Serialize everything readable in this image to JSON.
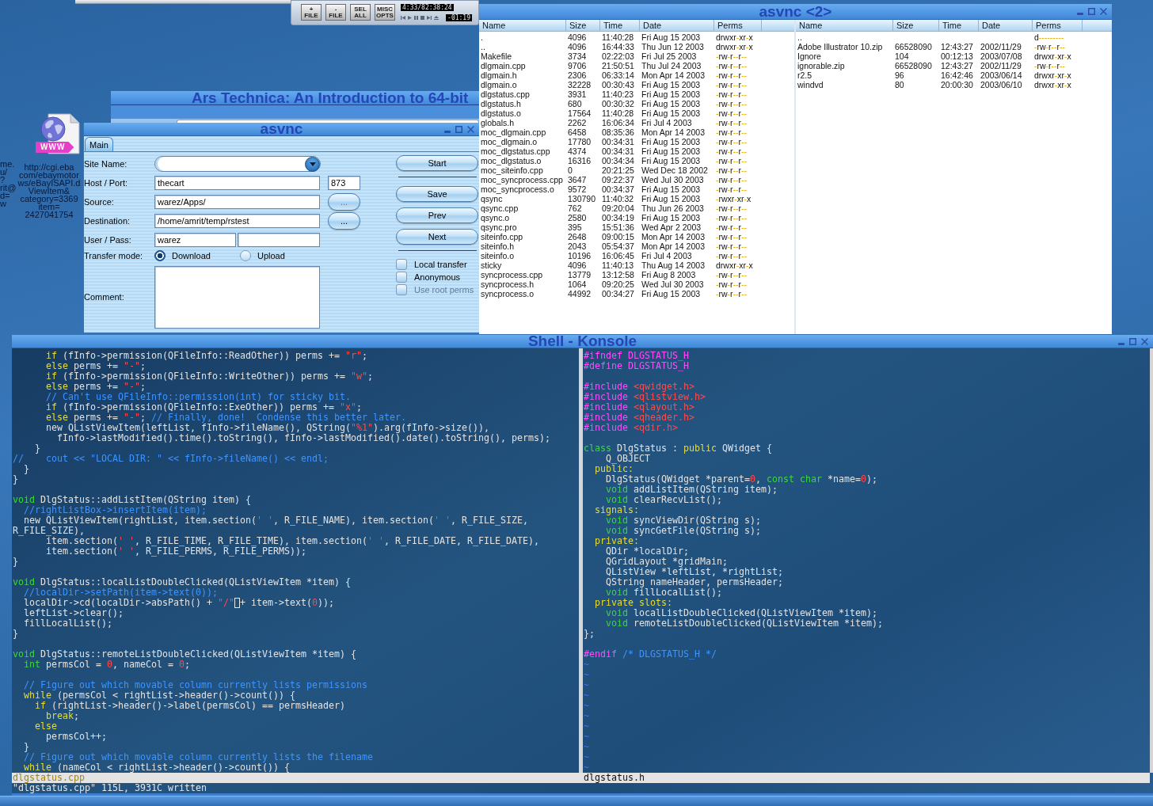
{
  "player": {
    "buttons": [
      "+ FILE",
      "- FILE",
      "SEL ALL",
      "MISC OPTS"
    ],
    "time_display": "4:33/82:38:24",
    "remaining_time": "-01:19"
  },
  "browser_window": {
    "title": "Ars Technica: An Introduction to 64-bit"
  },
  "desktop_icon": {
    "tag": "WWW",
    "label_lines": [
      "http://cgi.eba",
      "com/ebaymotor",
      "ws/eBayISAPI.d",
      "ViewItem&",
      "category=3369",
      "item=",
      "2427041754"
    ]
  },
  "edge_icon_label_lines": [
    "me.",
    "u/",
    "?",
    "rit@",
    "d=",
    "w"
  ],
  "dialog": {
    "title": "asvnc",
    "tabs": [
      {
        "label": "Main",
        "selected": true
      }
    ],
    "site_name": {
      "label": "Site Name:"
    },
    "host": {
      "label": "Host / Port:",
      "value": "thecart",
      "port": "873"
    },
    "source": {
      "label": "Source:",
      "value": "warez/Apps/",
      "browse": {
        "label": "...",
        "disabled": true
      }
    },
    "destination": {
      "label": "Destination:",
      "value": "/home/amrit/temp/rstest",
      "browse": {
        "label": "...",
        "disabled": false
      }
    },
    "user": {
      "label": "User / Pass:",
      "value": "warez"
    },
    "transfer_mode": {
      "label": "Transfer mode:",
      "options": [
        {
          "label": "Download",
          "selected": true
        },
        {
          "label": "Upload",
          "selected": false
        }
      ]
    },
    "comment": {
      "label": "Comment:"
    },
    "action_groups": [
      [
        {
          "label": "Start"
        }
      ],
      [
        {
          "label": "Save"
        },
        {
          "label": "Prev"
        },
        {
          "label": "Next"
        }
      ]
    ],
    "checkboxes": [
      {
        "label": "Local transfer",
        "checked": false,
        "disabled": false
      },
      {
        "label": "Anonymous",
        "checked": false,
        "disabled": false
      },
      {
        "label": "Use root perms",
        "checked": false,
        "disabled": true
      }
    ]
  },
  "sync_window": {
    "title": "asvnc <2>",
    "local_list": {
      "columns": [
        "Name",
        "Size",
        "Time",
        "Date",
        "Perms"
      ],
      "rows": [
        {
          "name": ".",
          "size": "4096",
          "time": "11:40:28",
          "date": "Fri Aug 15 2003",
          "perms": "drwxr-xr-x"
        },
        {
          "name": "..",
          "size": "4096",
          "time": "16:44:33",
          "date": "Thu Jun 12 2003",
          "perms": "drwxr-xr-x"
        },
        {
          "name": "Makefile",
          "size": "3734",
          "time": "02:22:03",
          "date": "Fri Jul 25 2003",
          "perms": "-rw-r--r--"
        },
        {
          "name": "dlgmain.cpp",
          "size": "9706",
          "time": "21:50:51",
          "date": "Thu Jul 24 2003",
          "perms": "-rw-r--r--"
        },
        {
          "name": "dlgmain.h",
          "size": "2306",
          "time": "06:33:14",
          "date": "Mon Apr 14 2003",
          "perms": "-rw-r--r--"
        },
        {
          "name": "dlgmain.o",
          "size": "32228",
          "time": "00:30:43",
          "date": "Fri Aug 15 2003",
          "perms": "-rw-r--r--"
        },
        {
          "name": "dlgstatus.cpp",
          "size": "3931",
          "time": "11:40:23",
          "date": "Fri Aug 15 2003",
          "perms": "-rw-r--r--"
        },
        {
          "name": "dlgstatus.h",
          "size": "680",
          "time": "00:30:32",
          "date": "Fri Aug 15 2003",
          "perms": "-rw-r--r--"
        },
        {
          "name": "dlgstatus.o",
          "size": "17564",
          "time": "11:40:28",
          "date": "Fri Aug 15 2003",
          "perms": "-rw-r--r--"
        },
        {
          "name": "globals.h",
          "size": "2262",
          "time": "16:06:34",
          "date": "Fri Jul 4 2003",
          "perms": "-rw-r--r--"
        },
        {
          "name": "moc_dlgmain.cpp",
          "size": "6458",
          "time": "08:35:36",
          "date": "Mon Apr 14 2003",
          "perms": "-rw-r--r--"
        },
        {
          "name": "moc_dlgmain.o",
          "size": "17780",
          "time": "00:34:31",
          "date": "Fri Aug 15 2003",
          "perms": "-rw-r--r--"
        },
        {
          "name": "moc_dlgstatus.cpp",
          "size": "4374",
          "time": "00:34:31",
          "date": "Fri Aug 15 2003",
          "perms": "-rw-r--r--"
        },
        {
          "name": "moc_dlgstatus.o",
          "size": "16316",
          "time": "00:34:34",
          "date": "Fri Aug 15 2003",
          "perms": "-rw-r--r--"
        },
        {
          "name": "moc_siteinfo.cpp",
          "size": "0",
          "time": "20:21:25",
          "date": "Wed Dec 18 2002",
          "perms": "-rw-r--r--"
        },
        {
          "name": "moc_syncprocess.cpp",
          "size": "3647",
          "time": "09:22:37",
          "date": "Wed Jul 30 2003",
          "perms": "-rw-r--r--"
        },
        {
          "name": "moc_syncprocess.o",
          "size": "9572",
          "time": "00:34:37",
          "date": "Fri Aug 15 2003",
          "perms": "-rw-r--r--"
        },
        {
          "name": "qsync",
          "size": "130790",
          "time": "11:40:32",
          "date": "Fri Aug 15 2003",
          "perms": "-rwxr-xr-x"
        },
        {
          "name": "qsync.cpp",
          "size": "762",
          "time": "09:20:04",
          "date": "Thu Jun 26 2003",
          "perms": "-rw-r--r--"
        },
        {
          "name": "qsync.o",
          "size": "2580",
          "time": "00:34:19",
          "date": "Fri Aug 15 2003",
          "perms": "-rw-r--r--"
        },
        {
          "name": "qsync.pro",
          "size": "395",
          "time": "15:51:36",
          "date": "Wed Apr 2 2003",
          "perms": "-rw-r--r--"
        },
        {
          "name": "siteinfo.cpp",
          "size": "2648",
          "time": "09:00:15",
          "date": "Mon Apr 14 2003",
          "perms": "-rw-r--r--"
        },
        {
          "name": "siteinfo.h",
          "size": "2043",
          "time": "05:54:37",
          "date": "Mon Apr 14 2003",
          "perms": "-rw-r--r--"
        },
        {
          "name": "siteinfo.o",
          "size": "10196",
          "time": "16:06:45",
          "date": "Fri Jul 4 2003",
          "perms": "-rw-r--r--"
        },
        {
          "name": "sticky",
          "size": "4096",
          "time": "11:40:13",
          "date": "Thu Aug 14 2003",
          "perms": "drwxr-xr-x"
        },
        {
          "name": "syncprocess.cpp",
          "size": "13779",
          "time": "13:12:58",
          "date": "Fri Aug 8 2003",
          "perms": "-rw-r--r--"
        },
        {
          "name": "syncprocess.h",
          "size": "1064",
          "time": "09:20:25",
          "date": "Wed Jul 30 2003",
          "perms": "-rw-r--r--"
        },
        {
          "name": "syncprocess.o",
          "size": "44992",
          "time": "00:34:27",
          "date": "Fri Aug 15 2003",
          "perms": "-rw-r--r--"
        }
      ]
    },
    "remote_list": {
      "columns": [
        "Name",
        "Size",
        "Time",
        "Date",
        "Perms"
      ],
      "rows": [
        {
          "name": "..",
          "perms": "d---------"
        },
        {
          "name": "Adobe Illustrator 10.zip",
          "size": "66528090",
          "time": "12:43:27",
          "date": "2002/11/29",
          "perms": "-rw-r--r--"
        },
        {
          "name": "Ignore",
          "size": "104",
          "time": "00:12:13",
          "date": "2003/07/08",
          "perms": "drwxr-xr-x"
        },
        {
          "name": "ignorable.zip",
          "size": "66528090",
          "time": "12:43:27",
          "date": "2002/11/29",
          "perms": "-rw-r--r--"
        },
        {
          "name": "r2.5",
          "size": "96",
          "time": "16:42:46",
          "date": "2003/06/14",
          "perms": "drwxr-xr-x"
        },
        {
          "name": "windvd",
          "size": "80",
          "time": "20:00:30",
          "date": "2003/06/10",
          "perms": "drwxr-xr-x"
        }
      ]
    }
  },
  "konsole": {
    "title": "Shell - Konsole",
    "panes": [
      {
        "current": true,
        "status": "dlgstatus.cpp",
        "lines": [
          {
            "kind": "code",
            "segments": [
              {
                "kind": "keyword",
                "text": "      if"
              },
              {
                "kind": "plain",
                "text": " (fInfo->permission(QFileInfo::ReadOther)) perms += "
              },
              {
                "kind": "string",
                "text": "\"r\""
              },
              {
                "kind": "plain",
                "text": ";"
              }
            ]
          },
          {
            "kind": "code",
            "segments": [
              {
                "kind": "keyword",
                "text": "      else"
              },
              {
                "kind": "plain",
                "text": " perms += "
              },
              {
                "kind": "string",
                "text": "\"-\""
              },
              {
                "kind": "plain",
                "text": ";"
              }
            ]
          },
          {
            "kind": "code",
            "segments": [
              {
                "kind": "keyword",
                "text": "      if"
              },
              {
                "kind": "plain",
                "text": " (fInfo->permission(QFileInfo::WriteOther)) perms += "
              },
              {
                "kind": "string",
                "text": "\"w\""
              },
              {
                "kind": "plain",
                "text": ";"
              }
            ]
          },
          {
            "kind": "code",
            "segments": [
              {
                "kind": "keyword",
                "text": "      else"
              },
              {
                "kind": "plain",
                "text": " perms += "
              },
              {
                "kind": "string",
                "text": "\"-\""
              },
              {
                "kind": "plain",
                "text": ";"
              }
            ]
          },
          {
            "kind": "code",
            "segments": [
              {
                "kind": "comment",
                "text": "      // Can't use QFileInfo::permission(int) for sticky bit."
              }
            ]
          },
          {
            "kind": "code",
            "segments": [
              {
                "kind": "keyword",
                "text": "      if"
              },
              {
                "kind": "plain",
                "text": " (fInfo->permission(QFileInfo::ExeOther)) perms += "
              },
              {
                "kind": "string",
                "text": "\"x\""
              },
              {
                "kind": "plain",
                "text": ";"
              }
            ]
          },
          {
            "kind": "code",
            "segments": [
              {
                "kind": "keyword",
                "text": "      else"
              },
              {
                "kind": "plain",
                "text": " perms += "
              },
              {
                "kind": "string",
                "text": "\"-\""
              },
              {
                "kind": "plain",
                "text": "; "
              },
              {
                "kind": "comment",
                "text": "// Finally, done!  Condense this better later."
              }
            ]
          },
          {
            "kind": "code",
            "segments": [
              {
                "kind": "plain",
                "text": "      new QListViewItem(leftList, fInfo->fileName(), QString("
              },
              {
                "kind": "string",
                "text": "\"%1\""
              },
              {
                "kind": "plain",
                "text": ").arg(fInfo->size()),"
              }
            ]
          },
          {
            "kind": "code",
            "segments": [
              {
                "kind": "plain",
                "text": "        fInfo->lastModified().time().toString(), fInfo->lastModified().date().toString(), perms);"
              }
            ]
          },
          {
            "kind": "code",
            "segments": [
              {
                "kind": "plain",
                "text": "    }"
              }
            ]
          },
          {
            "kind": "code",
            "segments": [
              {
                "kind": "comment",
                "text": "//    cout << \"LOCAL DIR: \" << fInfo->fileName() << endl;"
              }
            ]
          },
          {
            "kind": "code",
            "segments": [
              {
                "kind": "plain",
                "text": "  }"
              }
            ]
          },
          {
            "kind": "code",
            "segments": [
              {
                "kind": "plain",
                "text": "}"
              }
            ]
          },
          {
            "kind": "blank"
          },
          {
            "kind": "code",
            "segments": [
              {
                "kind": "type",
                "text": "void"
              },
              {
                "kind": "plain",
                "text": " DlgStatus::addListItem(QString item) {"
              }
            ]
          },
          {
            "kind": "code",
            "segments": [
              {
                "kind": "comment",
                "text": "  //rightListBox->insertItem(item);"
              }
            ]
          },
          {
            "kind": "code",
            "segments": [
              {
                "kind": "plain",
                "text": "  new QListViewItem(rightList, item.section("
              },
              {
                "kind": "string",
                "text": "' '"
              },
              {
                "kind": "plain",
                "text": ", R_FILE_NAME), item.section("
              },
              {
                "kind": "string",
                "text": "' '"
              },
              {
                "kind": "plain",
                "text": ", R_FILE_SIZE,"
              }
            ]
          },
          {
            "kind": "code",
            "segments": [
              {
                "kind": "plain",
                "text": "R_FILE_SIZE),"
              }
            ]
          },
          {
            "kind": "code",
            "segments": [
              {
                "kind": "plain",
                "text": "      item.section("
              },
              {
                "kind": "string",
                "text": "' '"
              },
              {
                "kind": "plain",
                "text": ", R_FILE_TIME, R_FILE_TIME), item.section("
              },
              {
                "kind": "string",
                "text": "' '"
              },
              {
                "kind": "plain",
                "text": ", R_FILE_DATE, R_FILE_DATE),"
              }
            ]
          },
          {
            "kind": "code",
            "segments": [
              {
                "kind": "plain",
                "text": "      item.section("
              },
              {
                "kind": "string",
                "text": "' '"
              },
              {
                "kind": "plain",
                "text": ", R_FILE_PERMS, R_FILE_PERMS));"
              }
            ]
          },
          {
            "kind": "code",
            "segments": [
              {
                "kind": "plain",
                "text": "}"
              }
            ]
          },
          {
            "kind": "blank"
          },
          {
            "kind": "code",
            "segments": [
              {
                "kind": "type",
                "text": "void"
              },
              {
                "kind": "plain",
                "text": " DlgStatus::localListDoubleClicked(QListViewItem *item) {"
              }
            ]
          },
          {
            "kind": "code",
            "segments": [
              {
                "kind": "comment",
                "text": "  //localDir->setPath(item->text(0));"
              }
            ]
          },
          {
            "kind": "code",
            "segments": [
              {
                "kind": "plain",
                "text": "  localDir->cd(localDir->absPath() + "
              },
              {
                "kind": "string",
                "text": "\"/\""
              },
              {
                "kind": "cursor"
              },
              {
                "kind": "plain",
                "text": "+ item->text("
              },
              {
                "kind": "number",
                "text": "0"
              },
              {
                "kind": "plain",
                "text": "));"
              }
            ]
          },
          {
            "kind": "code",
            "segments": [
              {
                "kind": "plain",
                "text": "  leftList->clear();"
              }
            ]
          },
          {
            "kind": "code",
            "segments": [
              {
                "kind": "plain",
                "text": "  fillLocalList();"
              }
            ]
          },
          {
            "kind": "code",
            "segments": [
              {
                "kind": "plain",
                "text": "}"
              }
            ]
          },
          {
            "kind": "blank"
          },
          {
            "kind": "code",
            "segments": [
              {
                "kind": "type",
                "text": "void"
              },
              {
                "kind": "plain",
                "text": " DlgStatus::remoteListDoubleClicked(QListViewItem *item) {"
              }
            ]
          },
          {
            "kind": "code",
            "segments": [
              {
                "kind": "type",
                "text": "  int"
              },
              {
                "kind": "plain",
                "text": " permsCol = "
              },
              {
                "kind": "number",
                "text": "0"
              },
              {
                "kind": "plain",
                "text": ", nameCol = "
              },
              {
                "kind": "number",
                "text": "0"
              },
              {
                "kind": "plain",
                "text": ";"
              }
            ]
          },
          {
            "kind": "blank"
          },
          {
            "kind": "code",
            "segments": [
              {
                "kind": "comment",
                "text": "  // Figure out which movable column currently lists permissions"
              }
            ]
          },
          {
            "kind": "code",
            "segments": [
              {
                "kind": "keyword",
                "text": "  while"
              },
              {
                "kind": "plain",
                "text": " (permsCol < rightList->header()->count()) {"
              }
            ]
          },
          {
            "kind": "code",
            "segments": [
              {
                "kind": "keyword",
                "text": "    if"
              },
              {
                "kind": "plain",
                "text": " (rightList->header()->label(permsCol) == permsHeader)"
              }
            ]
          },
          {
            "kind": "code",
            "segments": [
              {
                "kind": "keyword",
                "text": "      break"
              },
              {
                "kind": "plain",
                "text": ";"
              }
            ]
          },
          {
            "kind": "code",
            "segments": [
              {
                "kind": "keyword",
                "text": "    else"
              }
            ]
          },
          {
            "kind": "code",
            "segments": [
              {
                "kind": "plain",
                "text": "      permsCol++;"
              }
            ]
          },
          {
            "kind": "code",
            "segments": [
              {
                "kind": "plain",
                "text": "  }"
              }
            ]
          },
          {
            "kind": "code",
            "segments": [
              {
                "kind": "comment",
                "text": "  // Figure out which movable column currently lists the filename"
              }
            ]
          },
          {
            "kind": "code",
            "segments": [
              {
                "kind": "keyword",
                "text": "  while"
              },
              {
                "kind": "plain",
                "text": " (nameCol < rightList->header()->count()) {"
              }
            ]
          }
        ]
      },
      {
        "current": false,
        "status": "dlgstatus.h",
        "lines": [
          {
            "kind": "code",
            "segments": [
              {
                "kind": "preproc",
                "text": "#ifndef DLGSTATUS_H"
              }
            ]
          },
          {
            "kind": "code",
            "segments": [
              {
                "kind": "preproc",
                "text": "#define DLGSTATUS_H"
              }
            ]
          },
          {
            "kind": "blank"
          },
          {
            "kind": "code",
            "segments": [
              {
                "kind": "preproc",
                "text": "#include "
              },
              {
                "kind": "string",
                "text": "<qwidget.h>"
              }
            ]
          },
          {
            "kind": "code",
            "segments": [
              {
                "kind": "preproc",
                "text": "#include "
              },
              {
                "kind": "string",
                "text": "<qlistview.h>"
              }
            ]
          },
          {
            "kind": "code",
            "segments": [
              {
                "kind": "preproc",
                "text": "#include "
              },
              {
                "kind": "string",
                "text": "<qlayout.h>"
              }
            ]
          },
          {
            "kind": "code",
            "segments": [
              {
                "kind": "preproc",
                "text": "#include "
              },
              {
                "kind": "string",
                "text": "<qheader.h>"
              }
            ]
          },
          {
            "kind": "code",
            "segments": [
              {
                "kind": "preproc",
                "text": "#include "
              },
              {
                "kind": "string",
                "text": "<qdir.h>"
              }
            ]
          },
          {
            "kind": "blank"
          },
          {
            "kind": "code",
            "segments": [
              {
                "kind": "type",
                "text": "class"
              },
              {
                "kind": "plain",
                "text": " DlgStatus : "
              },
              {
                "kind": "keyword",
                "text": "public"
              },
              {
                "kind": "plain",
                "text": " QWidget {"
              }
            ]
          },
          {
            "kind": "code",
            "segments": [
              {
                "kind": "plain",
                "text": "    Q_OBJECT"
              }
            ]
          },
          {
            "kind": "code",
            "segments": [
              {
                "kind": "keyword",
                "text": "  public:"
              }
            ]
          },
          {
            "kind": "code",
            "segments": [
              {
                "kind": "plain",
                "text": "    DlgStatus(QWidget *parent="
              },
              {
                "kind": "number",
                "text": "0"
              },
              {
                "kind": "plain",
                "text": ", "
              },
              {
                "kind": "type",
                "text": "const char"
              },
              {
                "kind": "plain",
                "text": " *name="
              },
              {
                "kind": "number",
                "text": "0"
              },
              {
                "kind": "plain",
                "text": ");"
              }
            ]
          },
          {
            "kind": "code",
            "segments": [
              {
                "kind": "type",
                "text": "    void"
              },
              {
                "kind": "plain",
                "text": " addListItem(QString item);"
              }
            ]
          },
          {
            "kind": "code",
            "segments": [
              {
                "kind": "type",
                "text": "    void"
              },
              {
                "kind": "plain",
                "text": " clearRecvList();"
              }
            ]
          },
          {
            "kind": "code",
            "segments": [
              {
                "kind": "keyword",
                "text": "  signals:"
              }
            ]
          },
          {
            "kind": "code",
            "segments": [
              {
                "kind": "type",
                "text": "    void"
              },
              {
                "kind": "plain",
                "text": " syncViewDir(QString s);"
              }
            ]
          },
          {
            "kind": "code",
            "segments": [
              {
                "kind": "type",
                "text": "    void"
              },
              {
                "kind": "plain",
                "text": " syncGetFile(QString s);"
              }
            ]
          },
          {
            "kind": "code",
            "segments": [
              {
                "kind": "keyword",
                "text": "  private:"
              }
            ]
          },
          {
            "kind": "code",
            "segments": [
              {
                "kind": "plain",
                "text": "    QDir *localDir;"
              }
            ]
          },
          {
            "kind": "code",
            "segments": [
              {
                "kind": "plain",
                "text": "    QGridLayout *gridMain;"
              }
            ]
          },
          {
            "kind": "code",
            "segments": [
              {
                "kind": "plain",
                "text": "    QListView *leftList, *rightList;"
              }
            ]
          },
          {
            "kind": "code",
            "segments": [
              {
                "kind": "plain",
                "text": "    QString nameHeader, permsHeader;"
              }
            ]
          },
          {
            "kind": "code",
            "segments": [
              {
                "kind": "type",
                "text": "    void"
              },
              {
                "kind": "plain",
                "text": " fillLocalList();"
              }
            ]
          },
          {
            "kind": "code",
            "segments": [
              {
                "kind": "keyword",
                "text": "  private slots:"
              }
            ]
          },
          {
            "kind": "code",
            "segments": [
              {
                "kind": "type",
                "text": "    void"
              },
              {
                "kind": "plain",
                "text": " localListDoubleClicked(QListViewItem *item);"
              }
            ]
          },
          {
            "kind": "code",
            "segments": [
              {
                "kind": "type",
                "text": "    void"
              },
              {
                "kind": "plain",
                "text": " remoteListDoubleClicked(QListViewItem *item);"
              }
            ]
          },
          {
            "kind": "code",
            "segments": [
              {
                "kind": "plain",
                "text": "};"
              }
            ]
          },
          {
            "kind": "blank"
          },
          {
            "kind": "code",
            "segments": [
              {
                "kind": "preproc",
                "text": "#endif "
              },
              {
                "kind": "comment",
                "text": "/* DLGSTATUS_H */"
              }
            ]
          },
          {
            "kind": "filler",
            "text": "~"
          },
          {
            "kind": "filler",
            "text": "~"
          },
          {
            "kind": "filler",
            "text": "~"
          },
          {
            "kind": "filler",
            "text": "~"
          },
          {
            "kind": "filler",
            "text": "~"
          },
          {
            "kind": "filler",
            "text": "~"
          },
          {
            "kind": "filler",
            "text": "~"
          },
          {
            "kind": "filler",
            "text": "~"
          },
          {
            "kind": "filler",
            "text": "~"
          },
          {
            "kind": "filler",
            "text": "~"
          },
          {
            "kind": "filler",
            "text": "~"
          }
        ]
      }
    ],
    "command_line": "\"dlgstatus.cpp\" 115L, 3931C written"
  }
}
